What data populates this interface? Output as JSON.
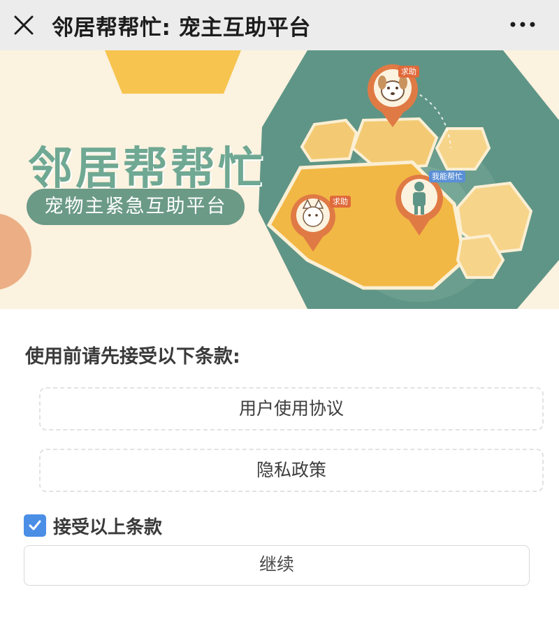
{
  "window": {
    "title": "邻居帮帮忙: 宠主互助平台",
    "close_icon": "close-icon",
    "more_icon": "more-dots-icon"
  },
  "banner": {
    "title": "邻居帮帮忙",
    "subtitle": "宠物主紧急互助平台",
    "badges": {
      "help_dog": "求助",
      "help_cat": "求助",
      "can_help": "我能帮忙"
    },
    "colors": {
      "background": "#fbf2df",
      "accent_green": "#6b9a87",
      "hex_yellow": "#f6c44f",
      "hex_teal": "#5f9586"
    }
  },
  "terms": {
    "prompt": "使用前请先接受以下条款:",
    "items": [
      {
        "label": "用户使用协议"
      },
      {
        "label": "隐私政策"
      }
    ],
    "accept": {
      "label": "接受以上条款",
      "checked": true
    },
    "continue_label": "继续"
  },
  "colors": {
    "checkbox_blue": "#4a8ee6"
  }
}
